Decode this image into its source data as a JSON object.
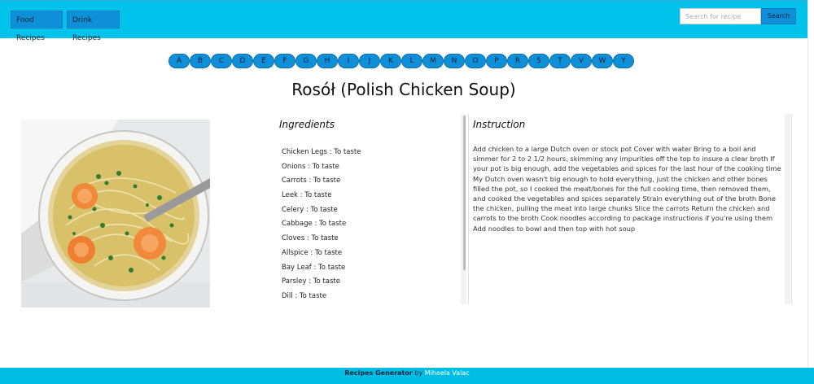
{
  "header": {
    "food_label": "Food Recipes",
    "drink_label": "Drink Recipes",
    "search_placeholder": "Search for recipe",
    "search_label": "Search"
  },
  "letters": [
    "A",
    "B",
    "C",
    "D",
    "E",
    "F",
    "G",
    "H",
    "I",
    "J",
    "K",
    "L",
    "M",
    "N",
    "O",
    "P",
    "R",
    "S",
    "T",
    "V",
    "W",
    "Y"
  ],
  "recipe": {
    "title": "Rosół (Polish Chicken Soup)",
    "ingredients_heading": "Ingredients",
    "ingredients": [
      "Chicken Legs : To taste",
      "Onions : To taste",
      "Carrots : To taste",
      "Leek : To taste",
      "Celery : To taste",
      "Cabbage : To taste",
      "Cloves : To taste",
      "Allspice : To taste",
      "Bay Leaf : To taste",
      "Parsley : To taste",
      "Dill : To taste"
    ],
    "instruction_heading": "Instruction",
    "instruction_text": "Add chicken to a large Dutch oven or stock pot Cover with water Bring to a boil and simmer for 2 to 2 1/2 hours, skimming any impurities off the top to insure a clear broth If your pot is big enough, add the vegetables and spices for the last hour of the cooking time My Dutch oven wasn't big enough to hold everything, just the chicken and other bones filled the pot, so I cooked the meat/bones for the full cooking time, then removed them, and cooked the vegetables and spices separately Strain everything out of the broth Bone the chicken, pulling the meat into large chunks Slice the carrots Return the chicken and carrots to the broth Cook noodles according to package instructions if you're using them Add noodles to bowl and then top with hot soup"
  },
  "footer": {
    "brand": "Recipes Generator",
    "by": "by",
    "author": "Mihaela Valac"
  },
  "colors": {
    "topbar": "#00c2ea",
    "button": "#0f8fd8",
    "footer": "#00bde6"
  }
}
